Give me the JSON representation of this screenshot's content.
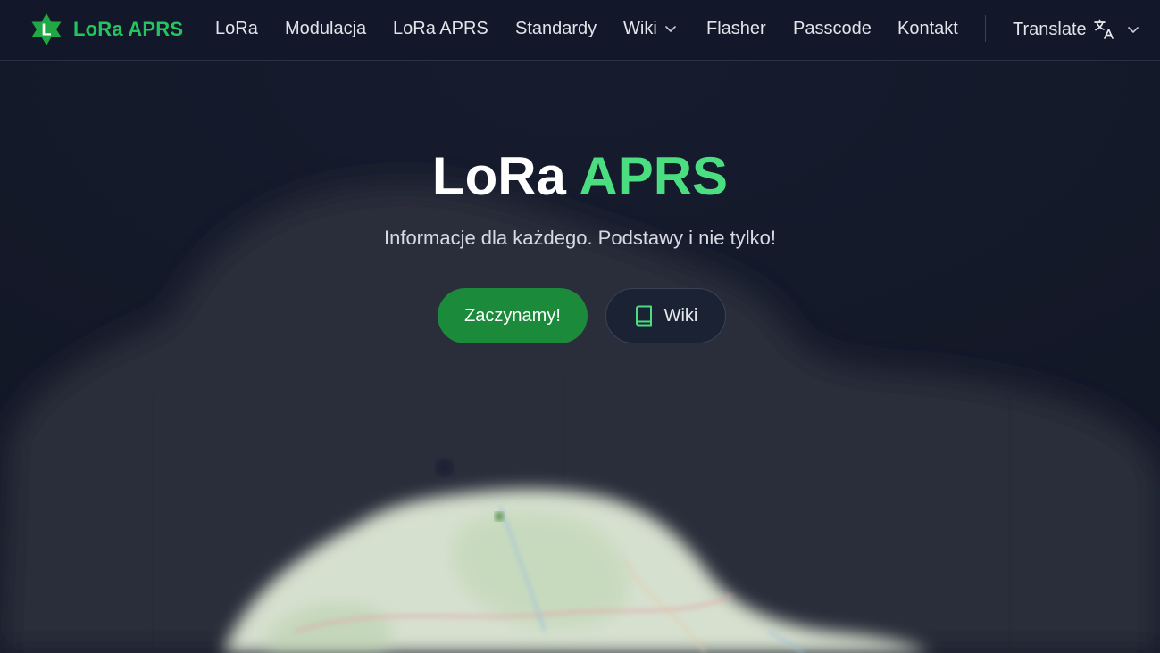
{
  "navbar": {
    "brand": {
      "logo_letter": "L",
      "text": "LoRa APRS"
    },
    "links": [
      {
        "label": "LoRa"
      },
      {
        "label": "Modulacja"
      },
      {
        "label": "LoRa APRS"
      },
      {
        "label": "Standardy"
      },
      {
        "label": "Wiki"
      },
      {
        "label": "Flasher"
      },
      {
        "label": "Passcode"
      },
      {
        "label": "Kontakt"
      }
    ],
    "translate": {
      "label": "Translate"
    }
  },
  "hero": {
    "title_main": "LoRa",
    "title_accent": "APRS",
    "subtitle": "Informacje dla każdego. Podstawy i nie tylko!",
    "primary_button": "Zaczynamy!",
    "secondary_button": "Wiki"
  },
  "colors": {
    "accent_green": "#22c55e",
    "title_green": "#4ade80",
    "button_green": "#1b8a3b",
    "background": "#141a2b"
  }
}
